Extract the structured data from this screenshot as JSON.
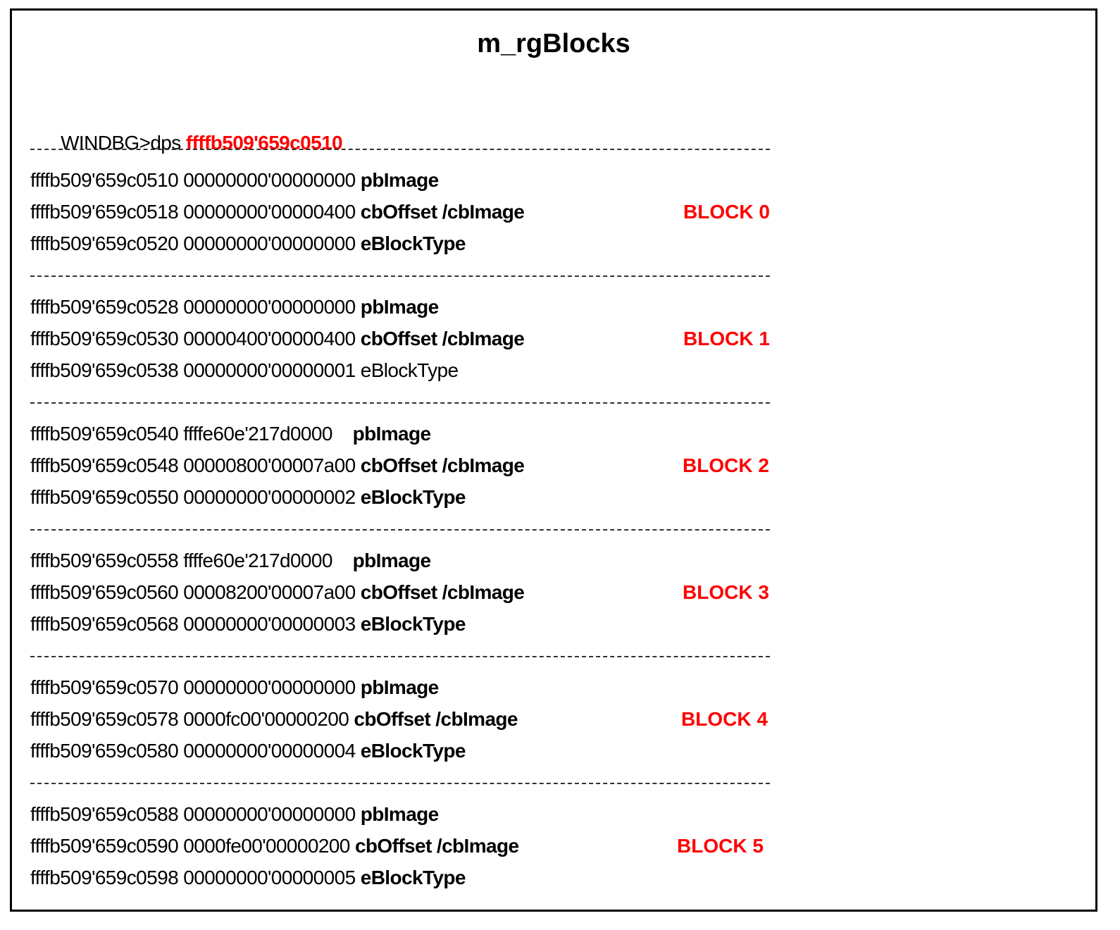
{
  "title": "m_rgBlocks",
  "command": {
    "prompt": "WINDBG>dps ",
    "address": "ffffb509'659c0510"
  },
  "accent_color": "#ff0000",
  "blocks": [
    {
      "label": "BLOCK 0",
      "rows": [
        {
          "addr": "ffffb509'659c0510",
          "value": "00000000'00000000",
          "field": "pbImage",
          "bold": true
        },
        {
          "addr": "ffffb509'659c0518",
          "value": "00000000'00000400",
          "field": "cbOffset /cbImage",
          "bold": true
        },
        {
          "addr": "ffffb509'659c0520",
          "value": "00000000'00000000",
          "field": "eBlockType",
          "bold": true
        }
      ]
    },
    {
      "label": "BLOCK 1",
      "rows": [
        {
          "addr": "ffffb509'659c0528",
          "value": "00000000'00000000",
          "field": "pbImage",
          "bold": true
        },
        {
          "addr": "ffffb509'659c0530",
          "value": "00000400'00000400",
          "field": "cbOffset /cbImage",
          "bold": true
        },
        {
          "addr": "ffffb509'659c0538",
          "value": "00000000'00000001",
          "field": "eBlockType",
          "bold": false
        }
      ]
    },
    {
      "label": "BLOCK 2",
      "rows": [
        {
          "addr": "ffffb509'659c0540",
          "value": "ffffe60e'217d0000   ",
          "field": "pbImage",
          "bold": true
        },
        {
          "addr": "ffffb509'659c0548",
          "value": "00000800'00007a00",
          "field": "cbOffset /cbImage",
          "bold": true
        },
        {
          "addr": "ffffb509'659c0550",
          "value": "00000000'00000002",
          "field": "eBlockType",
          "bold": true
        }
      ]
    },
    {
      "label": "BLOCK 3",
      "rows": [
        {
          "addr": "ffffb509'659c0558",
          "value": "ffffe60e'217d0000   ",
          "field": "pbImage",
          "bold": true
        },
        {
          "addr": "ffffb509'659c0560",
          "value": "00008200'00007a00",
          "field": "cbOffset /cbImage",
          "bold": true
        },
        {
          "addr": "ffffb509'659c0568",
          "value": "00000000'00000003",
          "field": "eBlockType",
          "bold": true
        }
      ]
    },
    {
      "label": "BLOCK 4",
      "rows": [
        {
          "addr": "ffffb509'659c0570",
          "value": "00000000'00000000",
          "field": "pbImage",
          "bold": true
        },
        {
          "addr": "ffffb509'659c0578",
          "value": "0000fc00'00000200",
          "field": "cbOffset /cbImage",
          "bold": true
        },
        {
          "addr": "ffffb509'659c0580",
          "value": "00000000'00000004",
          "field": "eBlockType",
          "bold": true
        }
      ]
    },
    {
      "label": "BLOCK 5",
      "rows": [
        {
          "addr": "ffffb509'659c0588",
          "value": "00000000'00000000",
          "field": "pbImage",
          "bold": true
        },
        {
          "addr": "ffffb509'659c0590",
          "value": "0000fe00'00000200",
          "field": "cbOffset /cbImage",
          "bold": true
        },
        {
          "addr": "ffffb509'659c0598",
          "value": "00000000'00000005",
          "field": "eBlockType",
          "bold": true
        }
      ]
    }
  ]
}
